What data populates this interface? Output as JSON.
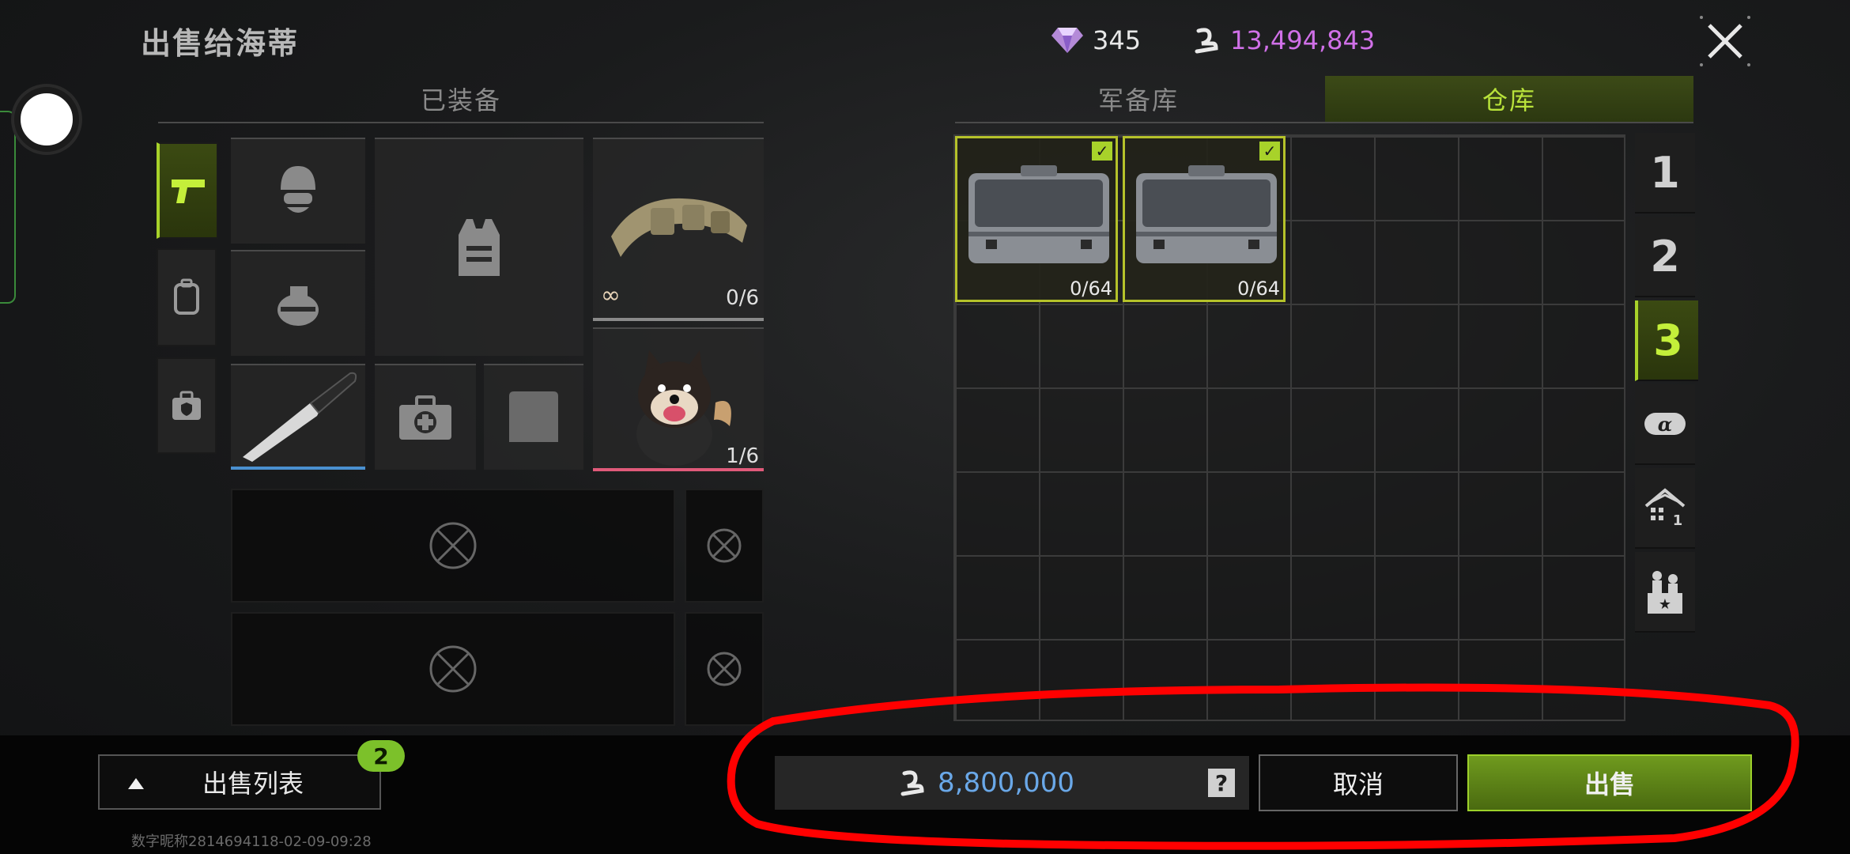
{
  "header": {
    "title": "出售给海蒂",
    "diamonds": "345",
    "coins": "13,494,843",
    "close_icon": "close-icon"
  },
  "left_panel": {
    "tab_label": "已装备",
    "side_tabs": [
      "pistol-icon",
      "backpack-icon",
      "shield-bag-icon"
    ],
    "belt_count": "0/6",
    "belt_infinity": "∞",
    "dog_count": "1/6"
  },
  "right_panel": {
    "tabs": [
      {
        "label": "军备库",
        "active": false
      },
      {
        "label": "仓库",
        "active": true
      }
    ],
    "cases": [
      {
        "count": "0/64",
        "checked": true
      },
      {
        "count": "0/64",
        "checked": true
      }
    ],
    "storage_tabs": [
      "1",
      "2",
      "3"
    ],
    "active_storage": "3",
    "extra_tabs": [
      "alpha-icon",
      "house-icon",
      "vendor-icon"
    ]
  },
  "bottom": {
    "sell_list_label": "出售列表",
    "sell_list_badge": "2",
    "price": "8,800,000",
    "help_mark": "?",
    "cancel_label": "取消",
    "sell_label": "出售",
    "watermark": "数字昵称2814694118-02-09-09:28"
  },
  "colors": {
    "accent_green": "#a8d22a",
    "coin_purple": "#d070e8",
    "price_blue": "#6aa8e8",
    "annotation_red": "#ff0000"
  }
}
